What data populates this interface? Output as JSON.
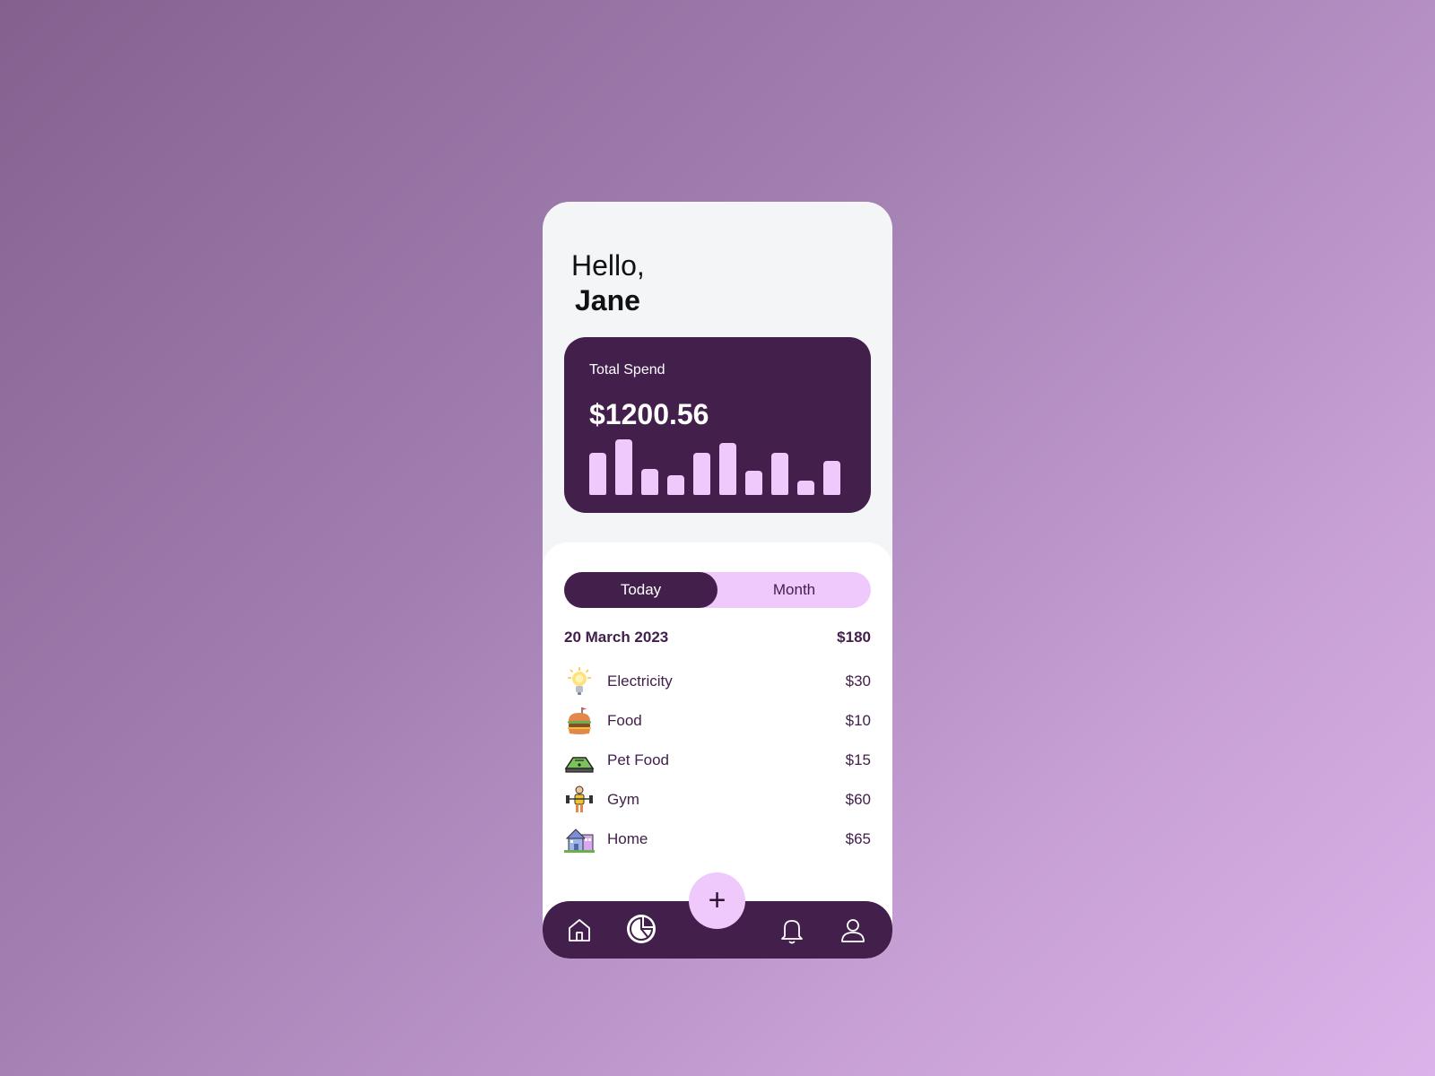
{
  "greeting": {
    "hello": "Hello,",
    "name": "Jane"
  },
  "spend_card": {
    "label": "Total Spend",
    "amount": "$1200.56",
    "bars": [
      0.75,
      1.0,
      0.47,
      0.35,
      0.75,
      0.93,
      0.44,
      0.75,
      0.26,
      0.62
    ]
  },
  "toggle": {
    "today": "Today",
    "month": "Month",
    "active": "Today"
  },
  "summary": {
    "date": "20 March 2023",
    "total": "$180"
  },
  "expenses": [
    {
      "label": "Electricity",
      "amount": "$30",
      "icon": "lightbulb-icon"
    },
    {
      "label": "Food",
      "amount": "$10",
      "icon": "burger-icon"
    },
    {
      "label": "Pet Food",
      "amount": "$15",
      "icon": "pet-bed-icon"
    },
    {
      "label": "Gym",
      "amount": "$60",
      "icon": "weightlifter-icon"
    },
    {
      "label": "Home",
      "amount": "$65",
      "icon": "house-icon"
    }
  ],
  "fab": {
    "symbol": "+"
  },
  "nav": [
    "home-icon",
    "chart-icon",
    "bell-icon",
    "user-icon"
  ],
  "colors": {
    "primary": "#42204b",
    "accent": "#efc8fc",
    "surface": "#f4f5f7"
  }
}
